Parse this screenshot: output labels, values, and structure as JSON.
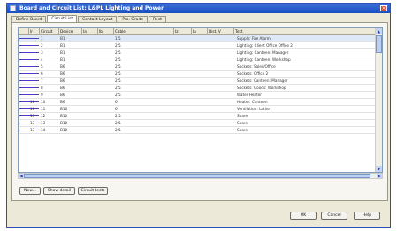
{
  "window": {
    "title": "Board and Circuit List: L&PL Lighting and Power"
  },
  "tabs": [
    {
      "label": "Define Board"
    },
    {
      "label": "Circuit List"
    },
    {
      "label": "Contact Layout"
    },
    {
      "label": "Pro. Grade"
    },
    {
      "label": "Rest"
    }
  ],
  "grid": {
    "columns": [
      "",
      "Ir",
      "Circuit",
      "Device",
      "Ia",
      "Ib",
      "Cable",
      "Iz",
      "Ia",
      "Dist. V",
      "Text"
    ],
    "rows": [
      {
        "cells": [
          "",
          "",
          "1",
          "B1",
          "",
          "",
          "1.5",
          "",
          "",
          "",
          "Supply: Fire Alarm"
        ]
      },
      {
        "cells": [
          "",
          "",
          "2",
          "B1",
          "",
          "",
          "2.5",
          "",
          "",
          "",
          "Lighting: Client Office Office 2"
        ]
      },
      {
        "cells": [
          "",
          "",
          "3",
          "B1",
          "",
          "",
          "2.5",
          "",
          "",
          "",
          "Lighting: Canteen: Manager"
        ]
      },
      {
        "cells": [
          "",
          "",
          "4",
          "B1",
          "",
          "",
          "2.5",
          "",
          "",
          "",
          "Lighting: Canteen: Workshop"
        ]
      },
      {
        "cells": [
          "",
          "",
          "5",
          "B6",
          "",
          "",
          "2.5",
          "",
          "",
          "",
          "Sockets: Sales/Office"
        ]
      },
      {
        "cells": [
          "",
          "",
          "6",
          "B6",
          "",
          "",
          "2.5",
          "",
          "",
          "",
          "Sockets: Office 2"
        ]
      },
      {
        "cells": [
          "",
          "",
          "7",
          "B6",
          "",
          "",
          "2.5",
          "",
          "",
          "",
          "Sockets: Canteen: Manager"
        ]
      },
      {
        "cells": [
          "",
          "",
          "8",
          "B6",
          "",
          "",
          "2.5",
          "",
          "",
          "",
          "Sockets: Goods: Workshop"
        ]
      },
      {
        "cells": [
          "",
          "",
          "9",
          "B6",
          "",
          "",
          "2.5",
          "",
          "",
          "",
          "Water Heater"
        ]
      },
      {
        "cells": [
          "",
          "16",
          "10",
          "B6",
          "",
          "",
          "6",
          "",
          "",
          "",
          "Heater: Canteen"
        ]
      },
      {
        "cells": [
          "",
          "16",
          "11",
          "B16",
          "",
          "",
          "6",
          "",
          "",
          "",
          "Ventilation: Lathe"
        ]
      },
      {
        "cells": [
          "",
          "13",
          "12",
          "B10",
          "",
          "",
          "2.5",
          "",
          "",
          "",
          "Spare"
        ]
      },
      {
        "cells": [
          "",
          "13",
          "13",
          "B10",
          "",
          "",
          "2.5",
          "",
          "",
          "",
          "Spare"
        ]
      },
      {
        "cells": [
          "",
          "13",
          "14",
          "B10",
          "",
          "",
          "2.5",
          "",
          "",
          "",
          "Spare"
        ]
      }
    ]
  },
  "buttons": {
    "new": "New...",
    "show_detail": "Show detail",
    "circuit_tests": "Circuit tests",
    "ok": "OK",
    "cancel": "Cancel",
    "help": "Help"
  },
  "icons": {
    "close": "close-icon",
    "app": "app-icon",
    "scroll_up": "scroll-up-icon",
    "scroll_down": "scroll-down-icon",
    "scroll_left": "scroll-left-icon",
    "scroll_right": "scroll-right-icon"
  }
}
